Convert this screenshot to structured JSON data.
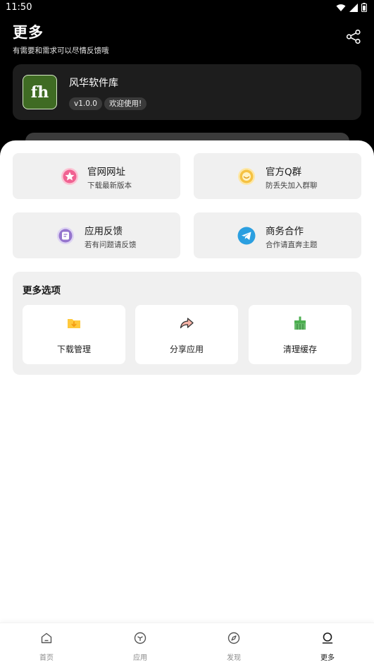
{
  "status_bar": {
    "time": "11:50"
  },
  "header": {
    "title": "更多",
    "subtitle": "有需要和需求可以尽情反馈哦"
  },
  "app_card": {
    "logo_text": "fh",
    "name": "风华软件库",
    "version_badge": "v1.0.0",
    "welcome_badge": "欢迎使用!"
  },
  "links": [
    {
      "title": "官网网址",
      "desc": "下载最新版本",
      "icon": "star-icon",
      "color": "#f06292"
    },
    {
      "title": "官方Q群",
      "desc": "防丢失加入群聊",
      "icon": "smile-icon",
      "color": "#f5c242"
    },
    {
      "title": "应用反馈",
      "desc": "若有问题请反馈",
      "icon": "feedback-icon",
      "color": "#9575cd"
    },
    {
      "title": "商务合作",
      "desc": "合作请直奔主题",
      "icon": "telegram-icon",
      "color": "#2b9fe0"
    }
  ],
  "more_options": {
    "title": "更多选项",
    "items": [
      {
        "label": "下载管理",
        "icon": "download-folder-icon"
      },
      {
        "label": "分享应用",
        "icon": "share-arrow-icon"
      },
      {
        "label": "清理缓存",
        "icon": "broom-icon"
      }
    ]
  },
  "bottom_nav": [
    {
      "label": "首页",
      "icon": "home-icon",
      "active": false
    },
    {
      "label": "应用",
      "icon": "cube-icon",
      "active": false
    },
    {
      "label": "发现",
      "icon": "compass-icon",
      "active": false
    },
    {
      "label": "更多",
      "icon": "profile-icon",
      "active": true
    }
  ]
}
